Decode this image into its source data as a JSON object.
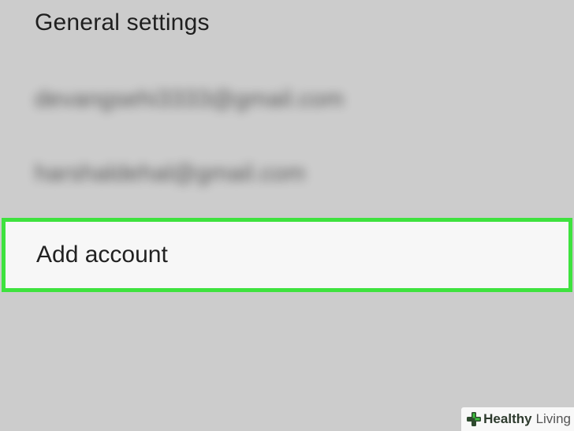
{
  "settings": {
    "general_settings_label": "General settings",
    "accounts": [
      {
        "email": "devangsehi3333@gmail.com"
      },
      {
        "email": "harshaldehal@gmail.com"
      }
    ],
    "add_account_label": "Add account"
  },
  "highlight": {
    "color": "#3ee23e"
  },
  "watermark": {
    "icon": "plus-cross-icon",
    "brand_first": "Healthy",
    "brand_second": "Living"
  }
}
